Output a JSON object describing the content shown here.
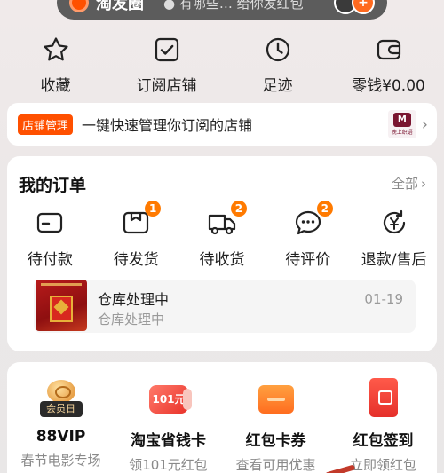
{
  "top_bar": {
    "brand": "淘发圈",
    "hint": "● 有哪些…  给你发红包",
    "avatar_count": "+"
  },
  "quick_actions": [
    {
      "label": "收藏",
      "icon": "star-icon"
    },
    {
      "label": "订阅店铺",
      "icon": "checkbox-icon"
    },
    {
      "label": "足迹",
      "icon": "clock-icon"
    },
    {
      "label": "零钱¥0.00",
      "icon": "wallet-icon"
    }
  ],
  "store_banner": {
    "tag": "店铺管理",
    "text": "一键快速管理你订阅的店铺",
    "logo_mark": "M",
    "logo_sub": "晚上织语"
  },
  "orders": {
    "title": "我的订单",
    "all_label": "全部",
    "statuses": [
      {
        "label": "待付款",
        "icon": "card-icon",
        "badge": ""
      },
      {
        "label": "待发货",
        "icon": "package-icon",
        "badge": "1"
      },
      {
        "label": "待收货",
        "icon": "truck-icon",
        "badge": "2"
      },
      {
        "label": "待评价",
        "icon": "comment-icon",
        "badge": "2"
      },
      {
        "label": "退款/售后",
        "icon": "refund-icon",
        "badge": ""
      }
    ],
    "recent": {
      "status": "仓库处理中",
      "sub": "仓库处理中",
      "date": "01-19"
    }
  },
  "services": [
    {
      "title": "88VIP",
      "sub": "春节电影专场",
      "icon": "vip-icon",
      "icon_text": "会员日"
    },
    {
      "title": "淘宝省钱卡",
      "sub": "领101元红包",
      "icon": "savings-card-icon",
      "icon_text": "101元"
    },
    {
      "title": "红包卡券",
      "sub": "查看可用优惠",
      "icon": "coupon-icon",
      "icon_text": ""
    },
    {
      "title": "红包签到",
      "sub": "立即领红包",
      "icon": "red-envelope-icon",
      "icon_text": ""
    }
  ],
  "colors": {
    "accent": "#ff5000",
    "badge": "#ff7a00",
    "muted_text": "#8a8a8a"
  }
}
